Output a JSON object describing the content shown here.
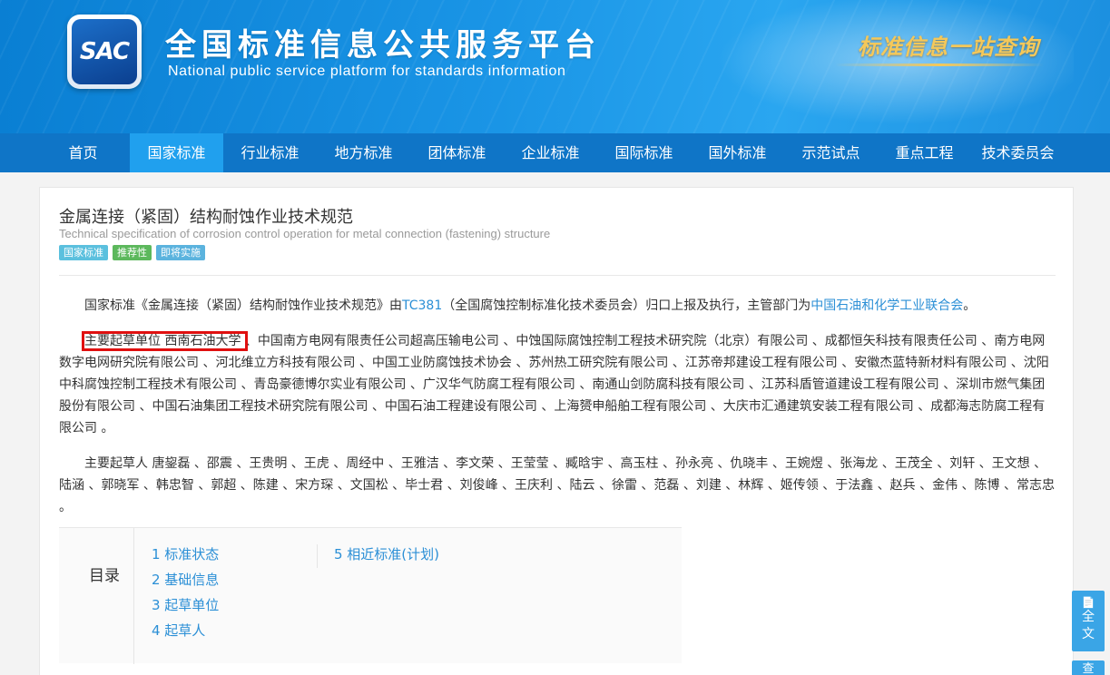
{
  "header": {
    "logo_text": "SAC",
    "title": "全国标准信息公共服务平台",
    "subtitle": "National public service platform  for standards information",
    "slogan": "标准信息一站查询"
  },
  "nav": {
    "items": [
      "首页",
      "国家标准",
      "行业标准",
      "地方标准",
      "团体标准",
      "企业标准",
      "国际标准",
      "国外标准",
      "示范试点",
      "重点工程",
      "技术委员会"
    ],
    "active": "国家标准"
  },
  "standard": {
    "title": "金属连接（紧固）结构耐蚀作业技术规范",
    "title_en": "Technical specification of corrosion control operation for metal connection (fastening) structure",
    "tags": [
      "国家标准",
      "推荐性",
      "即将实施"
    ]
  },
  "description": {
    "p1_prefix": "国家标准《金属连接（紧固）结构耐蚀作业技术规范》由",
    "p1_tc": "TC381",
    "p1_middle": "（全国腐蚀控制标准化技术委员会）归口上报及执行，主管部门为",
    "p1_dept": "中国石油和化学工业联合会",
    "p1_suffix": "。",
    "p2_highlight": "主要起草单位 西南石油大学 ",
    "p2_rest": "、中国南方电网有限责任公司超高压输电公司 、中蚀国际腐蚀控制工程技术研究院（北京）有限公司 、成都恒矢科技有限责任公司 、南方电网数字电网研究院有限公司 、河北维立方科技有限公司 、中国工业防腐蚀技术协会 、苏州热工研究院有限公司 、江苏帝邦建设工程有限公司 、安徽杰蓝特新材料有限公司 、沈阳中科腐蚀控制工程技术有限公司 、青岛豪德博尔实业有限公司 、广汉华气防腐工程有限公司 、南通山剑防腐科技有限公司 、江苏科盾管道建设工程有限公司 、深圳市燃气集团股份有限公司 、中国石油集团工程技术研究院有限公司 、中国石油工程建设有限公司 、上海赟申船舶工程有限公司 、大庆市汇通建筑安装工程有限公司 、成都海志防腐工程有限公司 。",
    "p3": "主要起草人 唐鋆磊 、邵震 、王贵明 、王虎 、周经中 、王雅洁 、李文荣 、王莹莹 、臧晗宇 、高玉柱 、孙永亮 、仇晓丰 、王婉煜 、张海龙 、王茂全 、刘轩 、王文想 、陆涵 、郭晓军 、韩忠智 、郭超 、陈建 、宋方琛 、文国松 、毕士君 、刘俊峰 、王庆利 、陆云 、徐雷 、范磊 、刘建 、林辉 、姬传领 、于法鑫 、赵兵 、金伟 、陈博 、常志忠 。"
  },
  "toc": {
    "label": "目录",
    "items": [
      "1  标准状态",
      "2  基础信息",
      "3  起草单位",
      "4  起草人",
      "5  相近标准(计划)"
    ]
  },
  "float": {
    "fulltext_1": "全",
    "fulltext_2": "文",
    "second": "查"
  }
}
